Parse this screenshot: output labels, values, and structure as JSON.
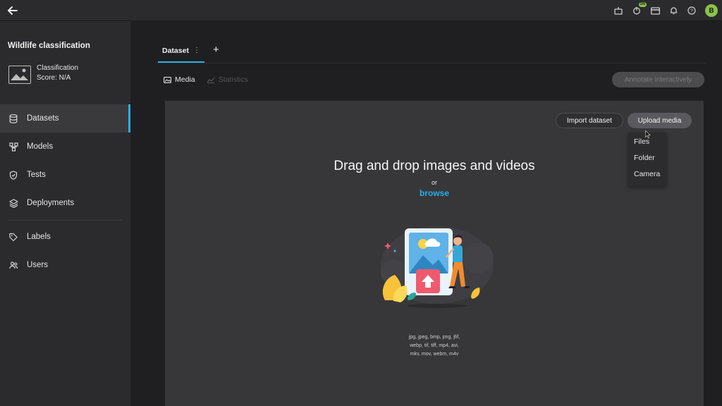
{
  "topbar": {
    "back_label": "Back",
    "icons": [
      "ai-icon",
      "power-icon",
      "card-icon",
      "bell-icon",
      "help-icon"
    ],
    "on_badge": "ON",
    "avatar_initial": "B"
  },
  "project": {
    "title": "Wildlife classification",
    "type": "Classification",
    "score": "Score: N/A"
  },
  "sidebar": {
    "items": [
      {
        "label": "Datasets",
        "icon": "database-icon",
        "active": true
      },
      {
        "label": "Models",
        "icon": "models-icon",
        "active": false
      },
      {
        "label": "Tests",
        "icon": "shield-icon",
        "active": false
      },
      {
        "label": "Deployments",
        "icon": "layers-icon",
        "active": false
      },
      {
        "label": "Labels",
        "icon": "tag-icon",
        "active": false
      },
      {
        "label": "Users",
        "icon": "users-icon",
        "active": false
      }
    ]
  },
  "tabs": {
    "dataset": "Dataset",
    "add": "+"
  },
  "subtabs": {
    "media": "Media",
    "statistics": "Statistics"
  },
  "actions": {
    "annotate": "Annotate interactively",
    "import": "Import dataset",
    "upload": "Upload media"
  },
  "upload_menu": [
    "Files",
    "Folder",
    "Camera"
  ],
  "dropzone": {
    "title": "Drag and drop images and videos",
    "or": "or",
    "browse": "browse",
    "formats": [
      "jpg, jpeg, bmp, png, jfif,",
      "webp, tif, tiff, mp4, avi,",
      "mkv, mov, webm, m4v"
    ]
  },
  "colors": {
    "accent": "#29aee6",
    "avatar": "#8bc34a",
    "upload_arrow": "#f05a6e"
  }
}
